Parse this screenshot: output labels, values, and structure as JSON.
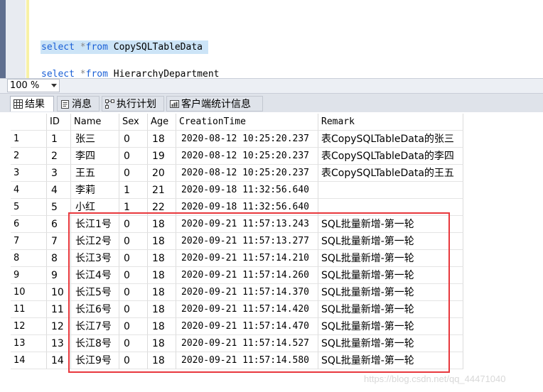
{
  "editor": {
    "line1": {
      "kw1": "select",
      "star": "*",
      "kw2": "from",
      "table": "CopySQLTableData"
    },
    "line2": {
      "kw1": "select",
      "star": "*",
      "kw2": "from",
      "table": "HierarchyDepartment"
    }
  },
  "zoom": {
    "value": "100 %"
  },
  "tabs": [
    {
      "label": "结果",
      "icon": "grid-icon"
    },
    {
      "label": "消息",
      "icon": "message-icon"
    },
    {
      "label": "执行计划",
      "icon": "execution-plan-icon"
    },
    {
      "label": "客户端统计信息",
      "icon": "client-statistics-icon"
    }
  ],
  "grid": {
    "columns": [
      "ID",
      "Name",
      "Sex",
      "Age",
      "CreationTime",
      "Remark"
    ],
    "rows": [
      [
        "1",
        "1",
        "张三",
        "0",
        "18",
        "2020-08-12 10:25:20.237",
        "表CopySQLTableData的张三"
      ],
      [
        "2",
        "2",
        "李四",
        "0",
        "19",
        "2020-08-12 10:25:20.237",
        "表CopySQLTableData的李四"
      ],
      [
        "3",
        "3",
        "王五",
        "0",
        "20",
        "2020-08-12 10:25:20.237",
        "表CopySQLTableData的王五"
      ],
      [
        "4",
        "4",
        "李莉",
        "1",
        "21",
        "2020-09-18 11:32:56.640",
        ""
      ],
      [
        "5",
        "5",
        "小红",
        "1",
        "22",
        "2020-09-18 11:32:56.640",
        ""
      ],
      [
        "6",
        "6",
        "长江1号",
        "0",
        "18",
        "2020-09-21 11:57:13.243",
        "SQL批量新增-第一轮"
      ],
      [
        "7",
        "7",
        "长江2号",
        "0",
        "18",
        "2020-09-21 11:57:13.277",
        "SQL批量新增-第一轮"
      ],
      [
        "8",
        "8",
        "长江3号",
        "0",
        "18",
        "2020-09-21 11:57:14.210",
        "SQL批量新增-第一轮"
      ],
      [
        "9",
        "9",
        "长江4号",
        "0",
        "18",
        "2020-09-21 11:57:14.260",
        "SQL批量新增-第一轮"
      ],
      [
        "10",
        "10",
        "长江5号",
        "0",
        "18",
        "2020-09-21 11:57:14.370",
        "SQL批量新增-第一轮"
      ],
      [
        "11",
        "11",
        "长江6号",
        "0",
        "18",
        "2020-09-21 11:57:14.420",
        "SQL批量新增-第一轮"
      ],
      [
        "12",
        "12",
        "长江7号",
        "0",
        "18",
        "2020-09-21 11:57:14.470",
        "SQL批量新增-第一轮"
      ],
      [
        "13",
        "13",
        "长江8号",
        "0",
        "18",
        "2020-09-21 11:57:14.527",
        "SQL批量新增-第一轮"
      ],
      [
        "14",
        "14",
        "长江9号",
        "0",
        "18",
        "2020-09-21 11:57:14.580",
        "SQL批量新增-第一轮"
      ]
    ]
  },
  "watermark": "https://blog.csdn.net/qq_44471040",
  "colors": {
    "highlight_border": "#e8383d",
    "keyword": "#1a5fd6",
    "selection": "#cce4f7"
  }
}
